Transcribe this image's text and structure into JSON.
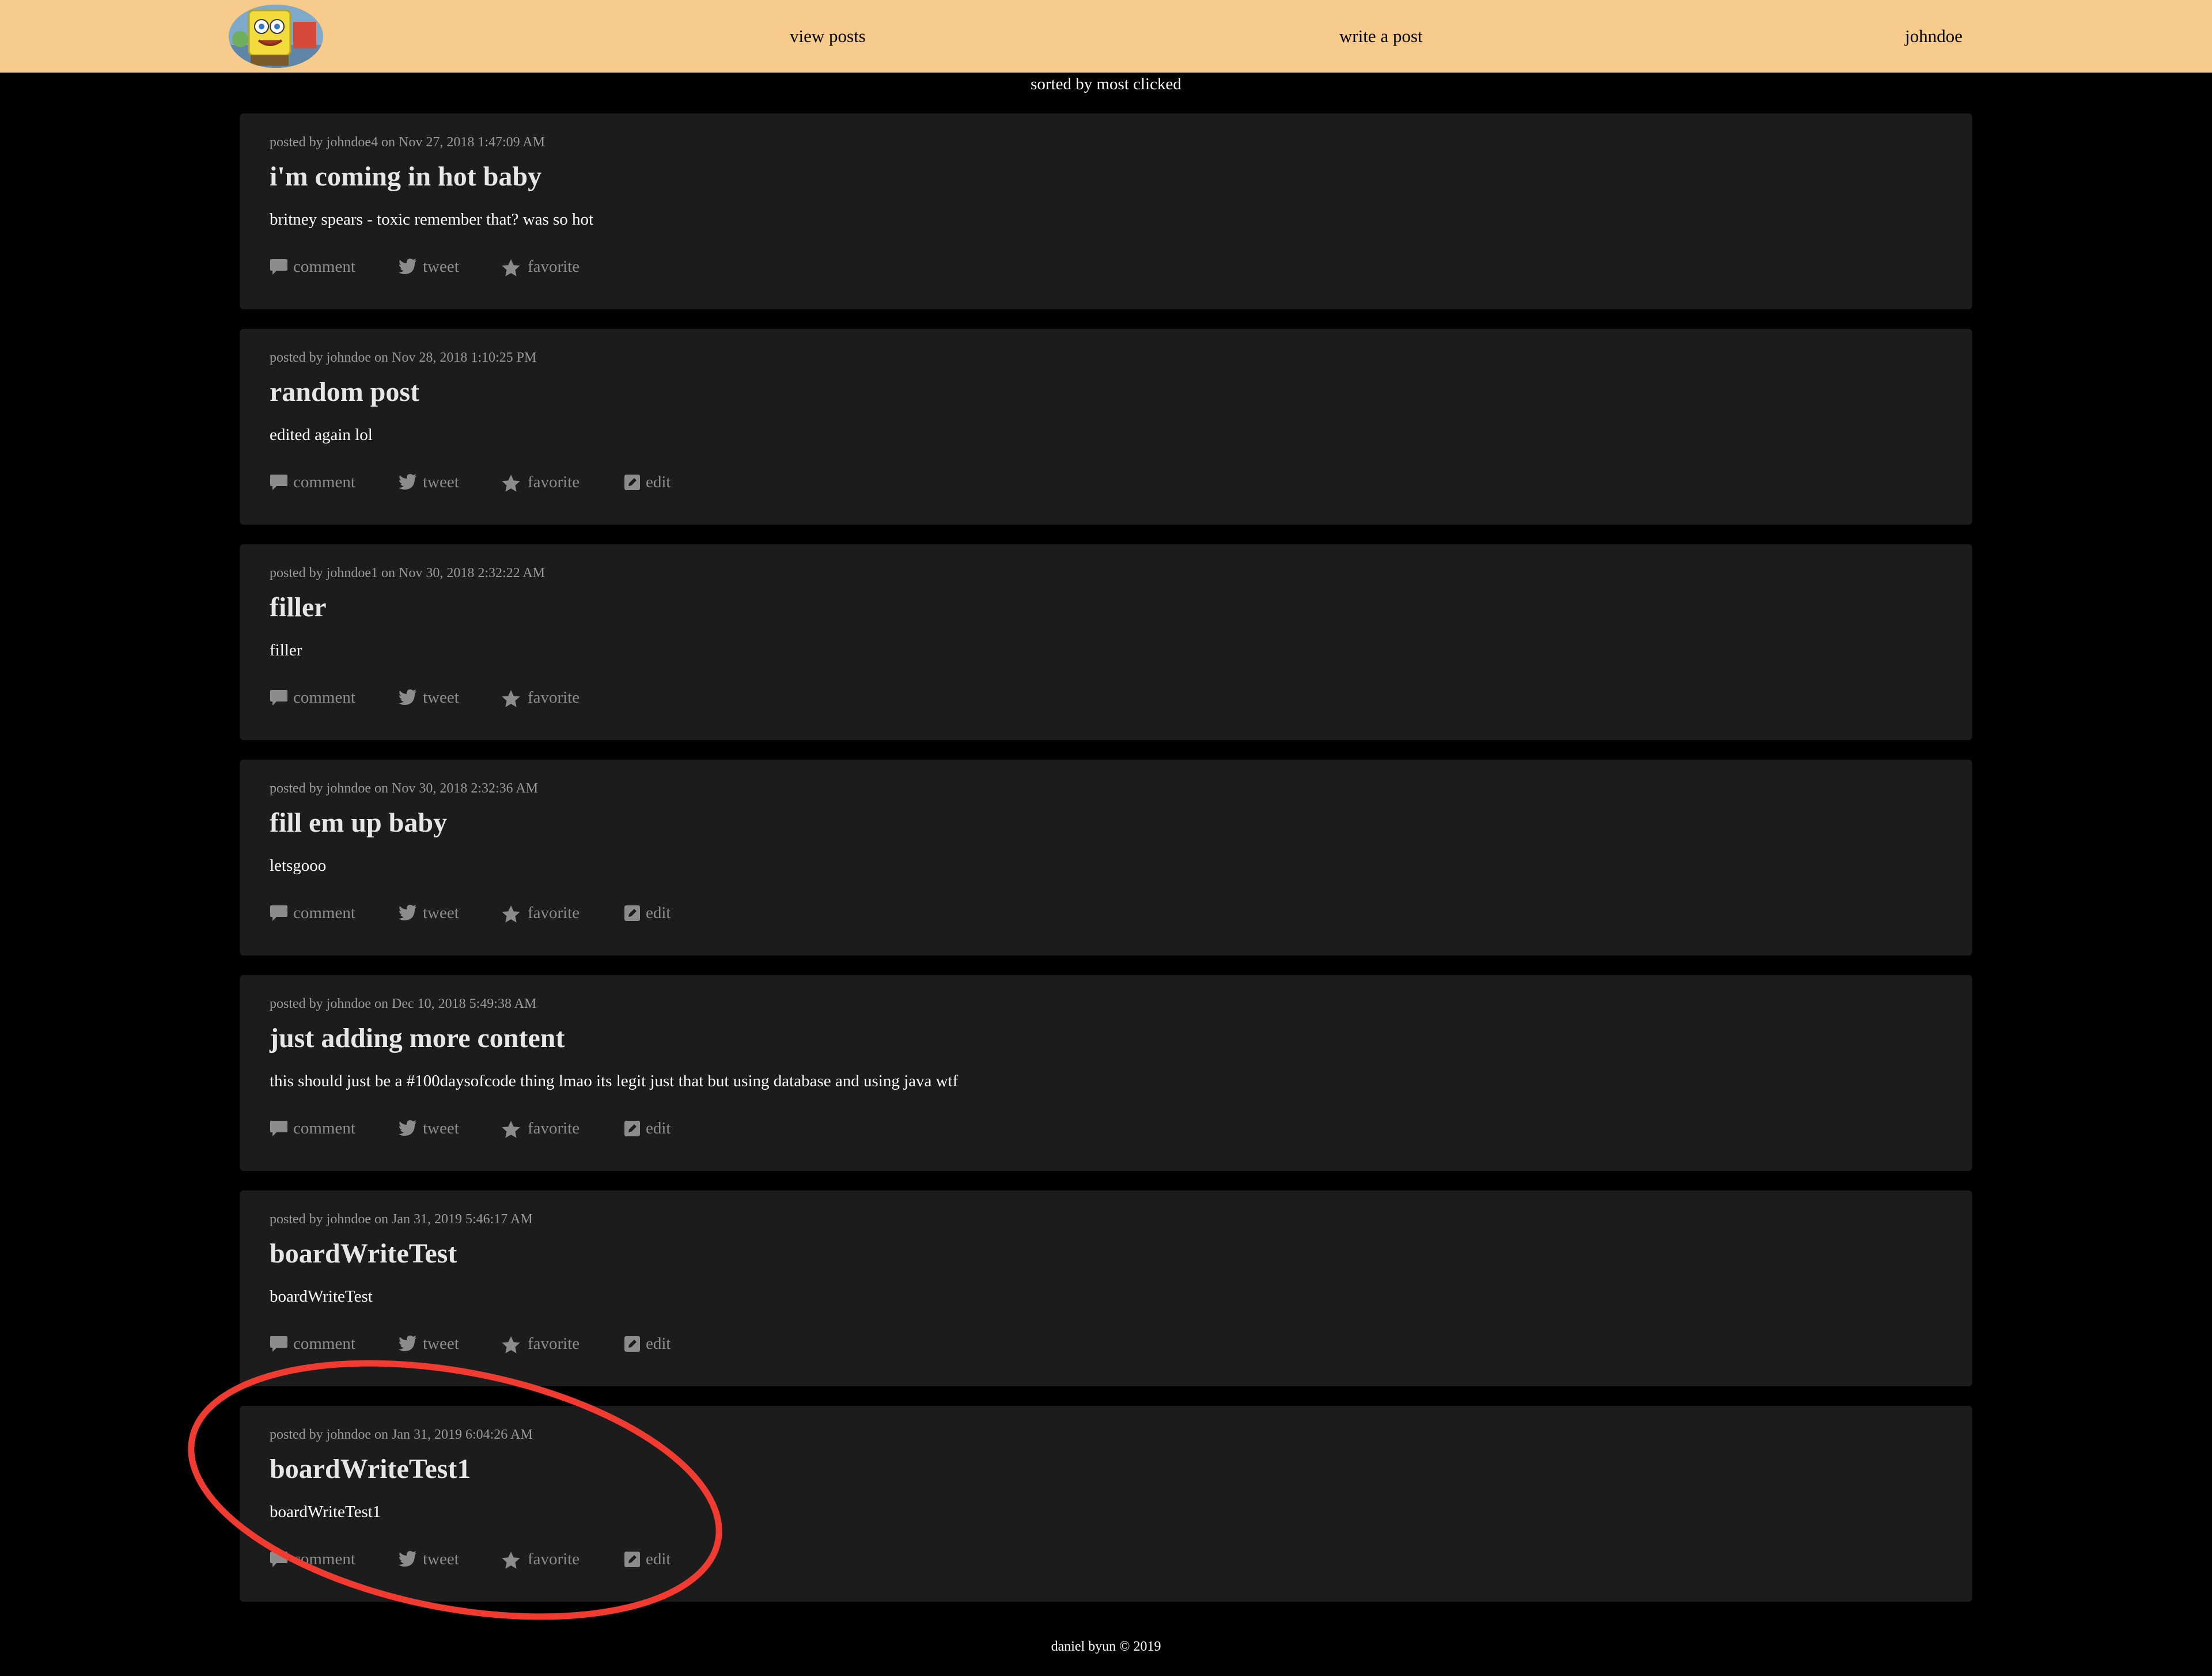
{
  "nav": {
    "logo_alt": "spongebob logo",
    "view_posts": "view posts",
    "write_post": "write a post",
    "user": "johndoe"
  },
  "sort_label": "sorted by most clicked",
  "posts": [
    {
      "meta": "posted by johndoe4 on Nov 27, 2018 1:47:09 AM",
      "title": "i'm coming in hot baby",
      "body": "britney spears - toxic remember that? was so hot",
      "has_edit": false
    },
    {
      "meta": "posted by johndoe on Nov 28, 2018 1:10:25 PM",
      "title": "random post",
      "body": "edited again lol",
      "has_edit": true
    },
    {
      "meta": "posted by johndoe1 on Nov 30, 2018 2:32:22 AM",
      "title": "filler",
      "body": "filler",
      "has_edit": false
    },
    {
      "meta": "posted by johndoe on Nov 30, 2018 2:32:36 AM",
      "title": "fill em up baby",
      "body": "letsgooo",
      "has_edit": true
    },
    {
      "meta": "posted by johndoe on Dec 10, 2018 5:49:38 AM",
      "title": "just adding more content",
      "body": "this should just be a #100daysofcode thing lmao its legit just that but using database and using java wtf",
      "has_edit": true
    },
    {
      "meta": "posted by johndoe on Jan 31, 2019 5:46:17 AM",
      "title": "boardWriteTest",
      "body": "boardWriteTest",
      "has_edit": true
    },
    {
      "meta": "posted by johndoe on Jan 31, 2019 6:04:26 AM",
      "title": "boardWriteTest1",
      "body": "boardWriteTest1",
      "has_edit": true
    }
  ],
  "actions": {
    "comment": "comment",
    "tweet": "tweet",
    "favorite": "favorite",
    "edit": "edit"
  },
  "footer": "daniel byun © 2019",
  "colors": {
    "navbar": "#f7cb8b",
    "card": "#1c1c1c",
    "highlight": "#f23b30"
  },
  "icons": {
    "comment": "comment-icon",
    "tweet": "twitter-bird-icon",
    "favorite": "star-icon",
    "edit": "edit-icon"
  }
}
